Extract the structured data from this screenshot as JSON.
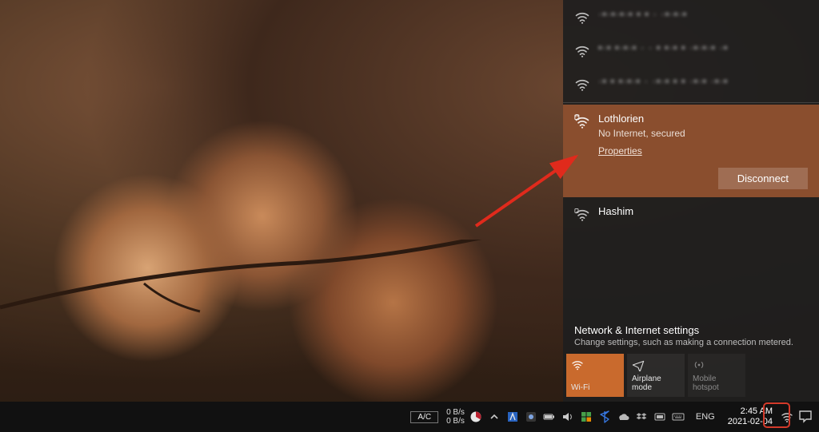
{
  "networks": {
    "hidden": [
      {
        "label": "·•·•·•·• • • · ·•·•·•"
      },
      {
        "label": "•·• •·•·• · · • •·• • ·•·•·• ·•"
      },
      {
        "label": "·• • •·•·• · ·•·• • • ·•·• ·•·•"
      }
    ],
    "selected": {
      "name": "Lothlorien",
      "status": "No Internet, secured",
      "properties_label": "Properties",
      "disconnect_label": "Disconnect"
    },
    "other": [
      {
        "name": "Hashim"
      }
    ]
  },
  "settings": {
    "title": "Network & Internet settings",
    "subtitle": "Change settings, such as making a connection metered."
  },
  "tiles": {
    "wifi": "Wi-Fi",
    "airplane": "Airplane mode",
    "hotspot": "Mobile hotspot"
  },
  "taskbar": {
    "kb": "A/C",
    "rate_up": "0 B/s",
    "rate_down": "0 B/s",
    "lang": "ENG",
    "time": "2:45 AM",
    "date": "2021-02-04"
  }
}
